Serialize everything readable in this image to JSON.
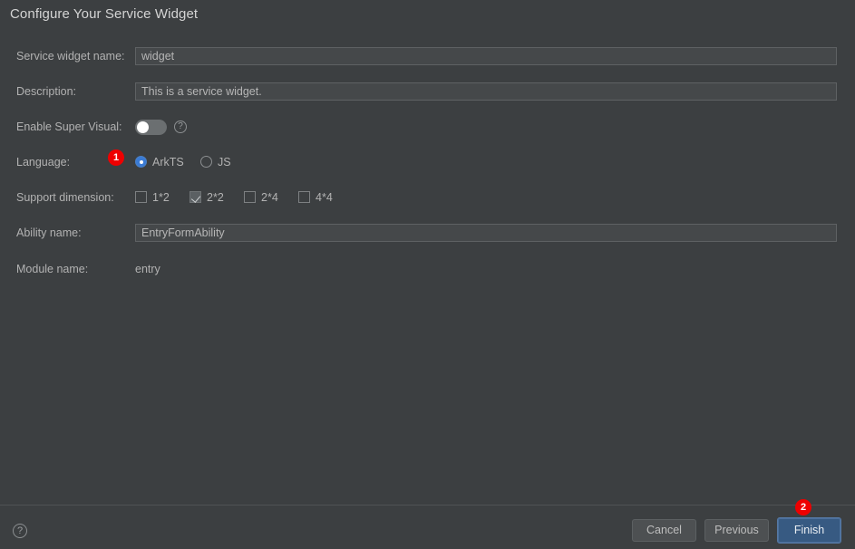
{
  "dialog": {
    "title": "Configure Your Service Widget"
  },
  "form": {
    "service_widget_name": {
      "label": "Service widget name:",
      "value": "widget",
      "placeholder": "widget"
    },
    "description": {
      "label": "Description:",
      "value": "This is a service widget.",
      "placeholder": "This is a service widget."
    },
    "enable_super_visual": {
      "label": "Enable Super Visual:",
      "state": "off",
      "help_icon": "question-circle-icon",
      "help_glyph": "?"
    },
    "language": {
      "label": "Language:",
      "selected": "ArkTS",
      "options": [
        {
          "label": "ArkTS",
          "selected": true
        },
        {
          "label": "JS",
          "selected": false
        }
      ]
    },
    "support_dimension": {
      "label": "Support dimension:",
      "options": [
        {
          "label": "1*2",
          "checked": false
        },
        {
          "label": "2*2",
          "checked": true
        },
        {
          "label": "2*4",
          "checked": false
        },
        {
          "label": "4*4",
          "checked": false
        }
      ]
    },
    "ability_name": {
      "label": "Ability name:",
      "value": "EntryFormAbility",
      "placeholder": "EntryFormAbility"
    },
    "module_name": {
      "label": "Module name:",
      "value": "entry"
    }
  },
  "badges": [
    {
      "id": "language",
      "text": "1"
    },
    {
      "id": "finish",
      "text": "2"
    }
  ],
  "footer": {
    "help_icon": "question-circle-icon",
    "help_glyph": "?",
    "cancel_label": "Cancel",
    "previous_label": "Previous",
    "finish_label": "Finish"
  },
  "colors": {
    "background": "#3c3f41",
    "input_background": "#45484a",
    "text": "#b2b2b2",
    "title_text": "#d4d4d4",
    "accent_blue": "#3a7bd5",
    "primary_button": "#375a82",
    "badge_red": "#ee0000",
    "separator": "#4f5254"
  }
}
